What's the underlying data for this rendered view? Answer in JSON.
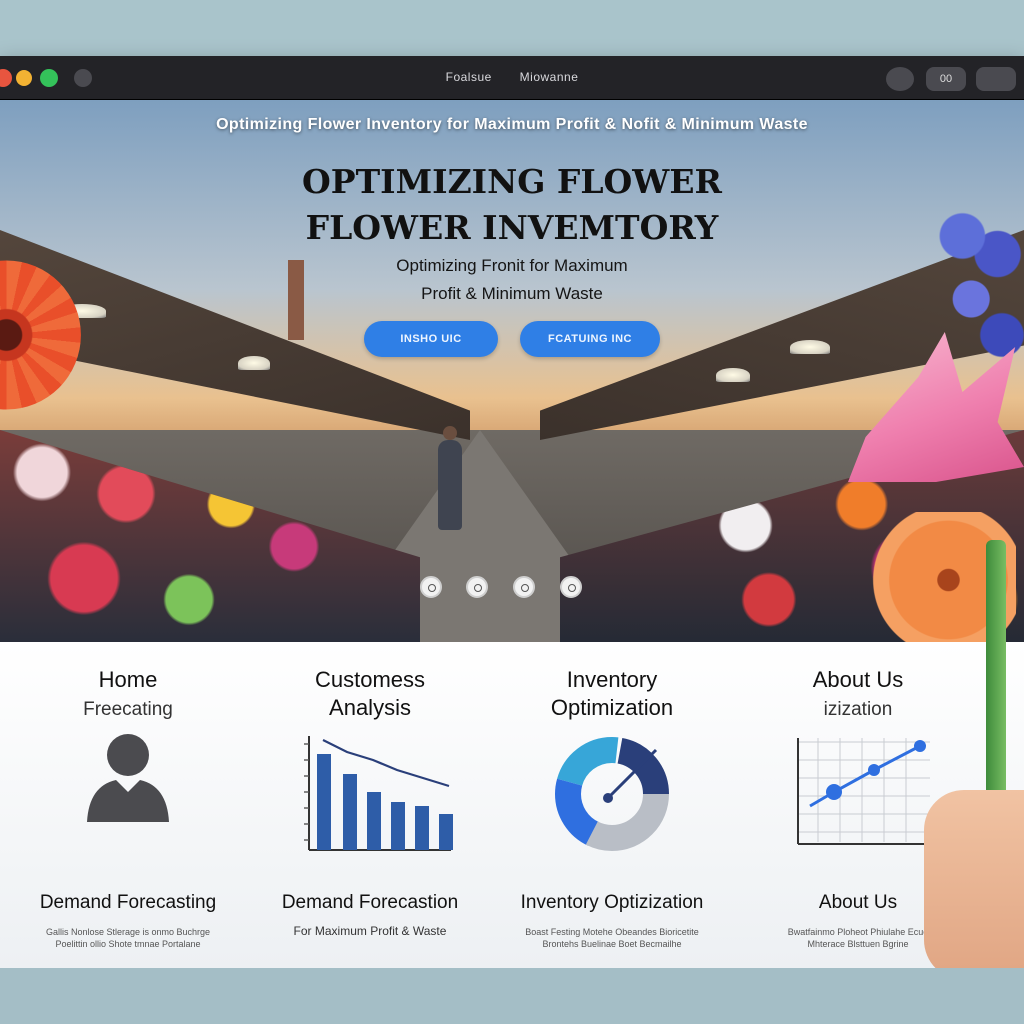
{
  "window": {
    "title_left": "Foalsue",
    "title_right": "Miowanne",
    "toolbar_btn_1": "",
    "toolbar_btn_2": "00",
    "toolbar_btn_3": ""
  },
  "hero": {
    "tagline": "Optimizing Flower Inventory for Maximum Profit & Nofit & Minimum Waste",
    "heading_line1": "OPTIMIZING FLOWER",
    "heading_line2": "FLOWER INVEMTORY",
    "sub_line1": "Optimizing Fronit for Maximum",
    "sub_line2": "Profit & Minimum Waste",
    "cta_primary": "INSHO UIC",
    "cta_secondary": "FCATUING INC"
  },
  "features": [
    {
      "heading_line1": "Home",
      "heading_line2": "Freecating",
      "icon": "user-avatar-icon",
      "name": "Demand Forecasting",
      "fine_line1": "Gallis Nonlose Stlerage is onmo Buchrge",
      "fine_line2": "Poelittin ollio Shote tmnae Portalane"
    },
    {
      "heading_line1": "Customess",
      "heading_line2": "Analysis",
      "icon": "bar-chart-icon",
      "name": "Demand Forecastion",
      "fine_line1": "For Maximum Profit & Waste",
      "fine_line2": ""
    },
    {
      "heading_line1": "Inventory",
      "heading_line2": "Optimization",
      "icon": "donut-gauge-icon",
      "name": "Inventory Optizization",
      "fine_line1": "Boast Festing Motehe Obeandes Bioricetite",
      "fine_line2": "Brontehs Buelinae Boet Becmailhe"
    },
    {
      "heading_line1": "About Us",
      "heading_line2": "izization",
      "icon": "line-chart-icon",
      "name": "About Us",
      "fine_line1": "Bwatfainmo Ploheot Phiulahe Ecue",
      "fine_line2": "Mhterace Blsttuen Bgrine"
    }
  ],
  "colors": {
    "accent": "#2f7fe6",
    "chart_blue": "#2e5da8",
    "titlebar": "#232327"
  }
}
